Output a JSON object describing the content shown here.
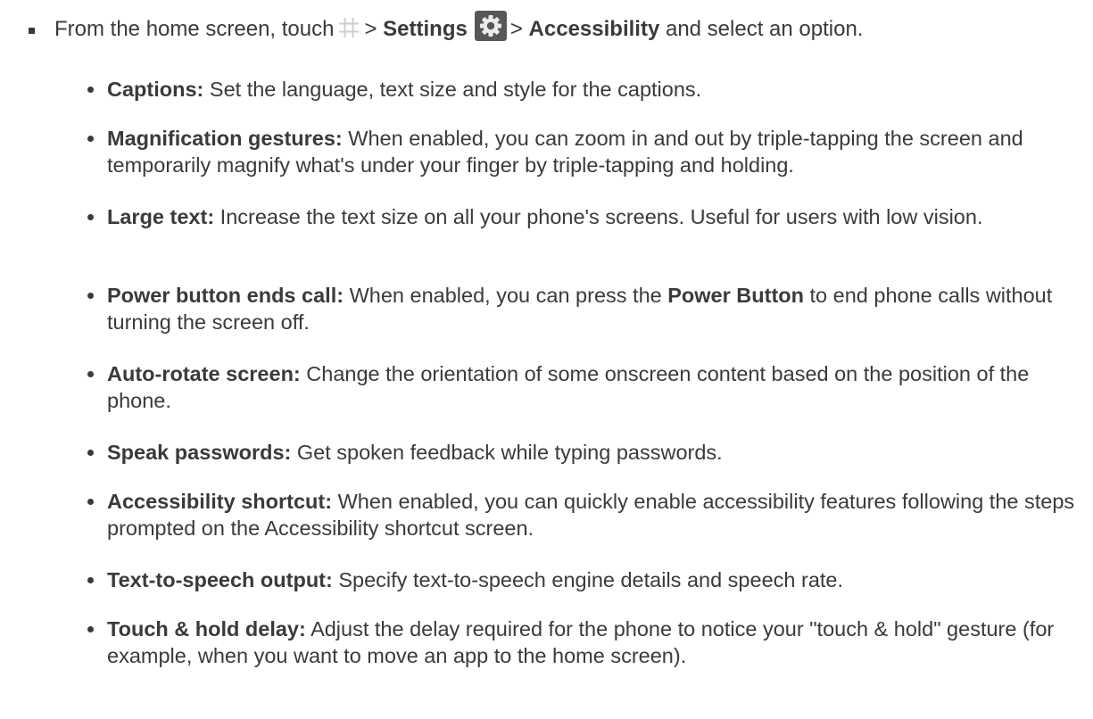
{
  "intro": {
    "prefix": "From the home screen, touch",
    "sep1": ">",
    "settings_label": "Settings",
    "sep2": ">",
    "accessibility_label": "Accessibility",
    "suffix": "and select an option.",
    "icons": [
      "apps-grid-icon",
      "settings-gear-icon"
    ]
  },
  "options": [
    {
      "term": "Captions:",
      "desc": "Set the language, text size and style for the captions."
    },
    {
      "term": "Magnification gestures:",
      "desc": "When enabled, you can zoom in and out by triple-tapping the screen and temporarily magnify what's under your finger by triple-tapping and holding."
    },
    {
      "term": "Large text:",
      "desc": "Increase the text size on all your phone's screens. Useful for users with low vision."
    },
    {
      "term": "Power button ends call:",
      "desc_before": "When enabled, you can press the",
      "desc_bold": "Power Button",
      "desc_after": "to end phone calls without turning the screen off."
    },
    {
      "term": "Auto-rotate screen:",
      "desc": "Change the orientation of some onscreen content based on the position of the phone."
    },
    {
      "term": "Speak passwords:",
      "desc": "Get spoken feedback while typing passwords."
    },
    {
      "term": "Accessibility shortcut:",
      "desc": "When enabled, you can quickly enable accessibility features following the steps prompted on the Accessibility shortcut screen."
    },
    {
      "term": "Text-to-speech output:",
      "desc": "Specify text-to-speech engine details and speech rate."
    },
    {
      "term": "Touch & hold delay:",
      "desc": "Adjust the delay required for the phone to notice your \"touch & hold\" gesture (for example, when you want to move an app to the home screen)."
    }
  ]
}
